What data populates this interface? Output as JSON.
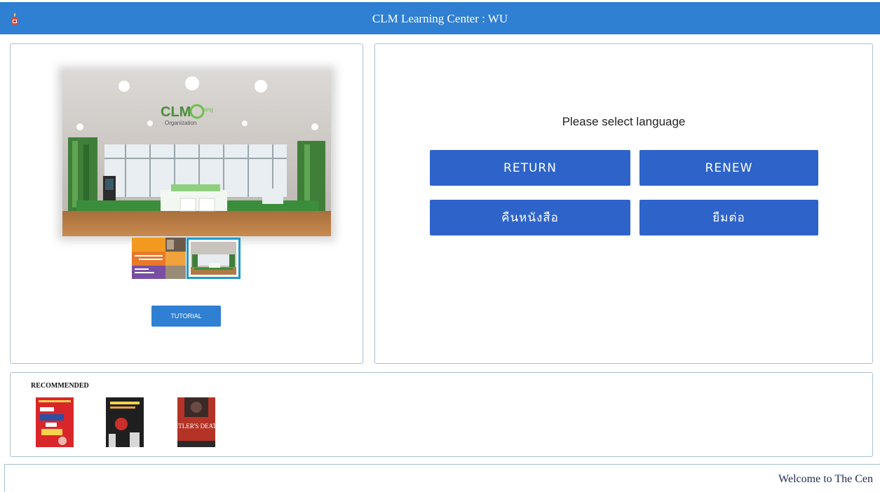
{
  "header": {
    "title": "CLM Learning Center : WU",
    "bg_color": "#2f7fd2",
    "logo_icon": "university-emblem-icon"
  },
  "left_panel": {
    "photo_alt": "CLM Going Green Organization",
    "photo_logo_text": "CLM",
    "photo_logo_suffix": "oing",
    "photo_logo_sub": "Organization",
    "tutorial_label": "TUTORIAL"
  },
  "language_panel": {
    "prompt": "Please select language",
    "buttons": {
      "return_label": "RETURN",
      "renew_label": "RENEW",
      "th_return_label": "คืนหนังสือ",
      "th_renew_label": "ยืมต่อ"
    },
    "button_color": "#2e64c9"
  },
  "recommended": {
    "title": "RECOMMENDED",
    "books": [
      {
        "cover_color": "#d9262b"
      },
      {
        "cover_color": "#1f1f1f"
      },
      {
        "cover_color": "#b53326",
        "cover_text": "HITLER'S DEATH"
      }
    ]
  },
  "footer": {
    "marquee_text": "Welcome to The Cen"
  }
}
